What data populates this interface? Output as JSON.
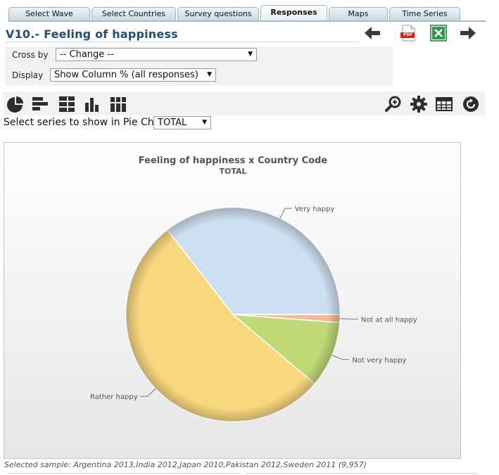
{
  "tabs": [
    {
      "label": "Select Wave",
      "active": false
    },
    {
      "label": "Select Countries",
      "active": false
    },
    {
      "label": "Survey questions",
      "active": false
    },
    {
      "label": "Responses",
      "active": true
    },
    {
      "label": "Maps",
      "active": false
    },
    {
      "label": "Time Series",
      "active": false
    }
  ],
  "page_title": "V10.- Feeling of happiness",
  "icons": {
    "back": "arrow-left-icon",
    "pdf": "pdf-icon",
    "pdf_text": "PDF",
    "excel": "excel-icon",
    "forward": "arrow-right-icon"
  },
  "options": {
    "cross_by_label": "Cross by",
    "cross_by_value": "-- Change --",
    "display_label": "Display",
    "display_value": "Show Column % (all responses)"
  },
  "toolbar": {
    "left_icons": [
      "pie-chart-icon",
      "horizontal-bar-icon",
      "stacked-horizontal-bar-icon",
      "column-chart-icon",
      "stacked-column-chart-icon"
    ],
    "right_icons": [
      "zoom-icon",
      "settings-icon",
      "table-icon",
      "refresh-icon"
    ]
  },
  "series_select": {
    "label": "Select series to show in Pie Chart",
    "value": "TOTAL"
  },
  "chart_data": {
    "type": "pie",
    "title": "Feeling of happiness x Country Code",
    "subtitle": "TOTAL",
    "slices": [
      {
        "label": "Very happy",
        "value": 35.5,
        "color": "#cde0f1"
      },
      {
        "label": "Not at all happy",
        "value": 1.2,
        "color": "#f6b898"
      },
      {
        "label": "Not very happy",
        "value": 10.0,
        "color": "#bfd977"
      },
      {
        "label": "Rather happy",
        "value": 53.3,
        "color": "#f8d77e"
      }
    ]
  },
  "footer": {
    "selected_sample": "Selected sample: Argentina 2013,India 2012,Japan 2010,Pakistan 2012,Sweden 2011 (9,957)"
  }
}
